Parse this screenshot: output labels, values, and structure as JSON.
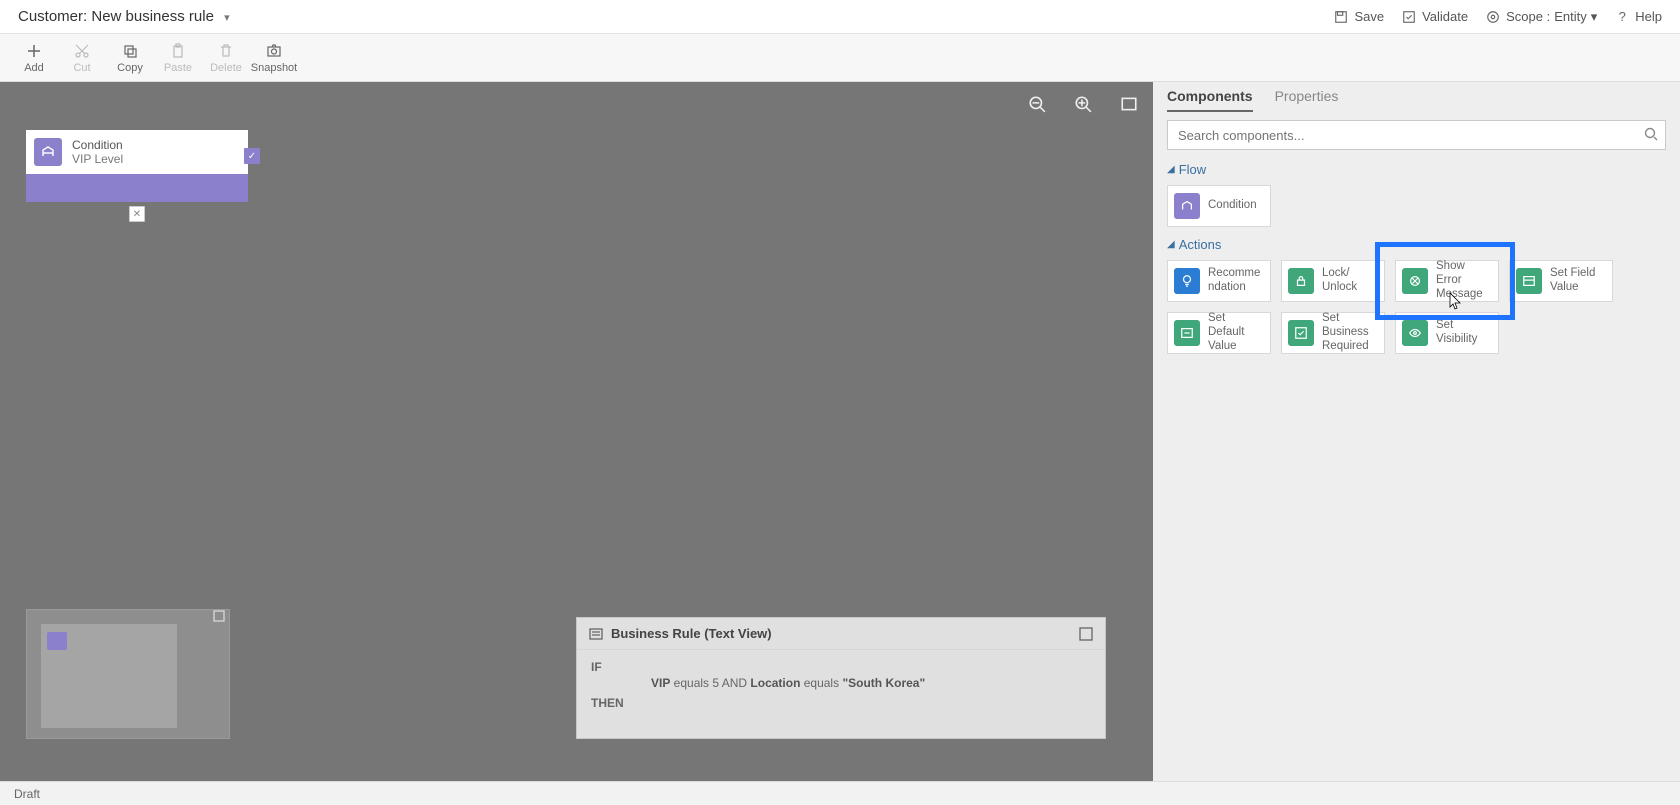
{
  "header": {
    "title_prefix": "Customer:",
    "title_main": "New business rule",
    "save": "Save",
    "validate": "Validate",
    "scope_label": "Scope :",
    "scope_value": "Entity",
    "help": "Help"
  },
  "toolbar": {
    "add": "Add",
    "cut": "Cut",
    "copy": "Copy",
    "paste": "Paste",
    "delete": "Delete",
    "snapshot": "Snapshot"
  },
  "canvas": {
    "condition": {
      "title": "Condition",
      "subtitle": "VIP Level"
    }
  },
  "textview": {
    "title": "Business Rule (Text View)",
    "if": "IF",
    "then": "THEN",
    "rule_html": {
      "vip": "VIP",
      "equals1": " equals ",
      "five": "5",
      "and": " AND ",
      "loc": "Location",
      "equals2": " equals ",
      "val": "\"South Korea\""
    }
  },
  "panel": {
    "tab_components": "Components",
    "tab_properties": "Properties",
    "search_placeholder": "Search components...",
    "section_flow": "Flow",
    "section_actions": "Actions",
    "flow": {
      "condition": "Condition"
    },
    "actions": {
      "recommendation": "Recommendation",
      "lock_unlock": "Lock/ Unlock",
      "show_error": "Show Error Message",
      "set_field_value": "Set Field Value",
      "set_default_value": "Set Default Value",
      "set_business_required": "Set Business Required",
      "set_visibility": "Set Visibility"
    }
  },
  "footer": {
    "status": "Draft"
  }
}
